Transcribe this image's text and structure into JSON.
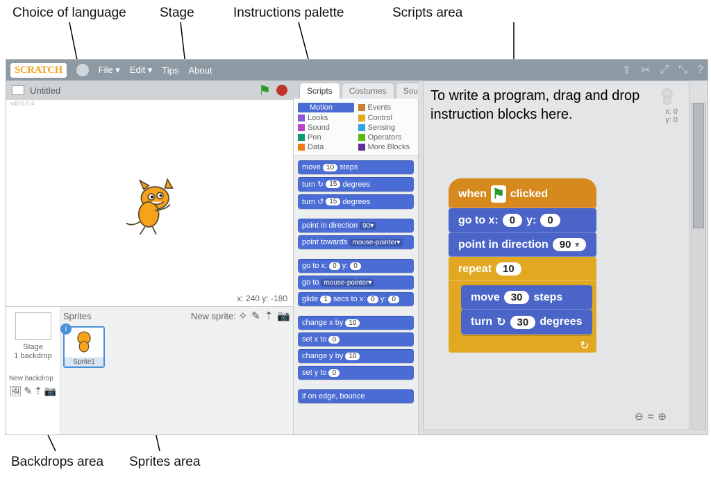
{
  "annotations": {
    "lang": "Choice of language",
    "stage": "Stage",
    "palette": "Instructions palette",
    "scripts": "Scripts area",
    "backdrops": "Backdrops area",
    "sprites": "Sprites area",
    "hint": "To write a program, drag and drop instruction blocks here."
  },
  "toolbar": {
    "logo": "SCRATCH",
    "menus": [
      "File ▾",
      "Edit ▾",
      "Tips",
      "About"
    ]
  },
  "project": {
    "title": "Untitled",
    "version": "v400.0.4"
  },
  "stage": {
    "coords": "x: 240  y: -180"
  },
  "sprites": {
    "panel_label": "Sprites",
    "new_sprite": "New sprite:",
    "sprite1": "Sprite1",
    "backdrop_title": "Stage",
    "backdrop_sub": "1 backdrop",
    "new_backdrop": "New backdrop"
  },
  "tabs": {
    "scripts": "Scripts",
    "costumes": "Costumes",
    "sounds": "Sounds"
  },
  "categories": {
    "motion": "Motion",
    "looks": "Looks",
    "sound": "Sound",
    "pen": "Pen",
    "data": "Data",
    "events": "Events",
    "control": "Control",
    "sensing": "Sensing",
    "operators": "Operators",
    "more": "More Blocks"
  },
  "palette_blocks": [
    {
      "t": "move",
      "txt_a": "move",
      "num": "10",
      "txt_b": "steps"
    },
    {
      "t": "turn_r",
      "txt_a": "turn ↻",
      "num": "15",
      "txt_b": "degrees"
    },
    {
      "t": "turn_l",
      "txt_a": "turn ↺",
      "num": "15",
      "txt_b": "degrees"
    },
    {
      "t": "gap"
    },
    {
      "t": "point_dir",
      "txt_a": "point in direction",
      "dd": "90▾"
    },
    {
      "t": "point_to",
      "txt_a": "point towards",
      "dd": "mouse-pointer▾"
    },
    {
      "t": "gap"
    },
    {
      "t": "gotoxy",
      "txt_a": "go to x:",
      "num": "0",
      "txt_b": "y:",
      "num2": "0"
    },
    {
      "t": "goto",
      "txt_a": "go to",
      "dd": "mouse-pointer▾"
    },
    {
      "t": "glide",
      "txt_a": "glide",
      "num": "1",
      "txt_b": "secs to x:",
      "num2": "0",
      "txt_c": "y:",
      "num3": "0"
    },
    {
      "t": "gap"
    },
    {
      "t": "chx",
      "txt_a": "change x by",
      "num": "10"
    },
    {
      "t": "setx",
      "txt_a": "set x to",
      "num": "0"
    },
    {
      "t": "chy",
      "txt_a": "change y by",
      "num": "10"
    },
    {
      "t": "sety",
      "txt_a": "set y to",
      "num": "0"
    },
    {
      "t": "gap"
    },
    {
      "t": "edge",
      "txt_a": "if on edge, bounce"
    }
  ],
  "script": {
    "hat": "when",
    "hat2": "clicked",
    "goto_a": "go to x:",
    "goto_v1": "0",
    "goto_b": "y:",
    "goto_v2": "0",
    "point": "point in direction",
    "point_v": "90",
    "repeat": "repeat",
    "repeat_v": "10",
    "move": "move",
    "move_v": "30",
    "move_b": "steps",
    "turn": "turn",
    "turn_v": "30",
    "turn_b": "degrees"
  },
  "sprite_info": {
    "x": "x: 0",
    "y": "y: 0"
  }
}
